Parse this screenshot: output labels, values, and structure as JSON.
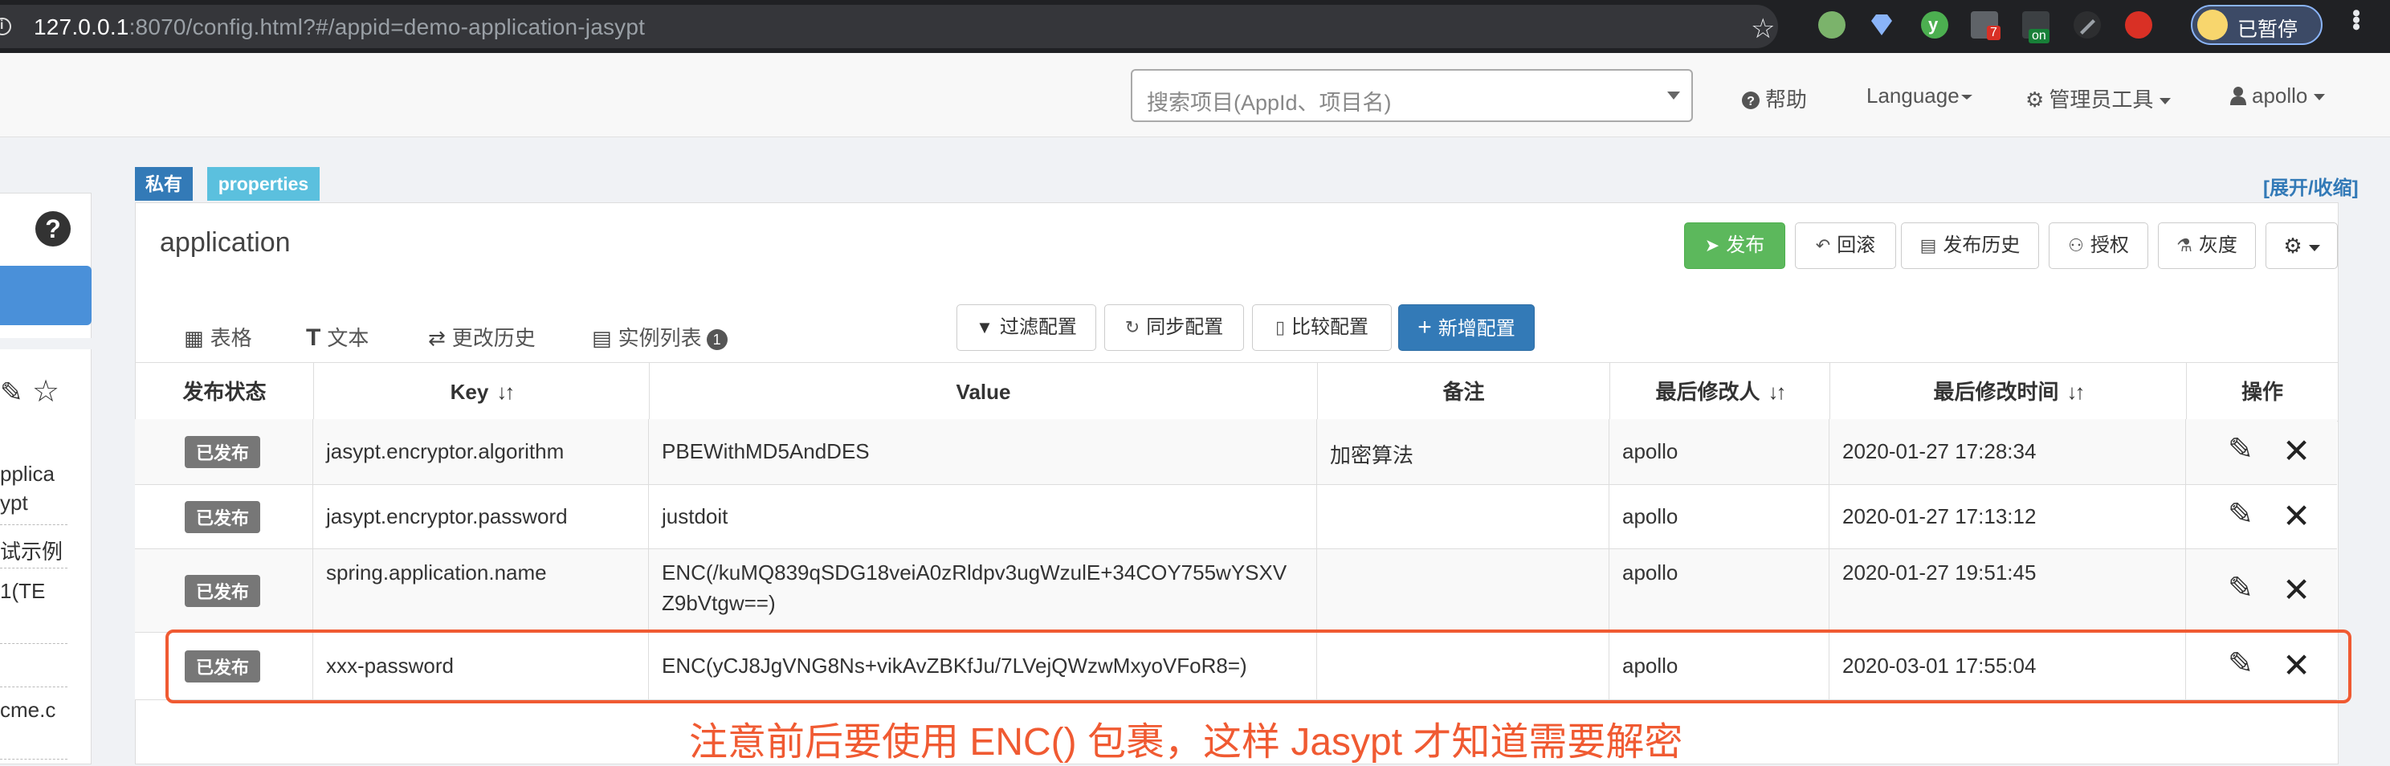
{
  "browser": {
    "url_host": "127.0.0.1",
    "url_rest": ":8070/config.html?#/appid=demo-application-jasypt",
    "ext_badge_count": "7",
    "ext_on_label": "on",
    "profile_label": "已暂停"
  },
  "navbar": {
    "search_placeholder": "搜索项目(AppId、项目名)",
    "help": "帮助",
    "language": "Language",
    "admin_tools": "管理员工具",
    "user": "apollo"
  },
  "sidebar": {
    "texts": [
      "pplica",
      "ypt",
      "试示例",
      "1(TE",
      "cme.c"
    ]
  },
  "namespace": {
    "badge_private": "私有",
    "badge_format": "properties",
    "toggle": "[展开/收缩]",
    "title": "application",
    "buttons": {
      "publish": "发布",
      "rollback": "回滚",
      "history": "发布历史",
      "grant": "授权",
      "gray": "灰度"
    },
    "tabs": {
      "table": "表格",
      "text": "文本",
      "change_history": "更改历史",
      "instances": "实例列表",
      "instances_count": "1"
    },
    "tools": {
      "filter": "过滤配置",
      "sync": "同步配置",
      "compare": "比较配置",
      "add": "新增配置"
    }
  },
  "table": {
    "headers": {
      "status": "发布状态",
      "key": "Key",
      "value": "Value",
      "comment": "备注",
      "modifier": "最后修改人",
      "modified_time": "最后修改时间",
      "ops": "操作"
    },
    "rows": [
      {
        "status": "已发布",
        "key": "jasypt.encryptor.algorithm",
        "value": "PBEWithMD5AndDES",
        "value2": "",
        "comment": "加密算法",
        "modifier": "apollo",
        "time": "2020-01-27 17:28:34"
      },
      {
        "status": "已发布",
        "key": "jasypt.encryptor.password",
        "value": "justdoit",
        "value2": "",
        "comment": "",
        "modifier": "apollo",
        "time": "2020-01-27 17:13:12"
      },
      {
        "status": "已发布",
        "key": "spring.application.name",
        "value": "ENC(/kuMQ839qSDG18veiA0zRldpv3ugWzulE+34COY755wYSXV",
        "value2": "Z9bVtgw==)",
        "comment": "",
        "modifier": "apollo",
        "time": "2020-01-27 19:51:45"
      },
      {
        "status": "已发布",
        "key": "xxx-password",
        "value": "ENC(yCJ8JgVNG8Ns+vikAvZBKfJu/7LVejQWzwMxyoVFoR8=)",
        "value2": "",
        "comment": "",
        "modifier": "apollo",
        "time": "2020-03-01 17:55:04"
      }
    ]
  },
  "annotation": "注意前后要使用 ENC() 包裹，这样 Jasypt 才知道需要解密",
  "colors": {
    "highlight": "#f05a32",
    "publish_green": "#5cb85c",
    "primary_blue": "#337ab7",
    "badge_info": "#5bc0de"
  }
}
